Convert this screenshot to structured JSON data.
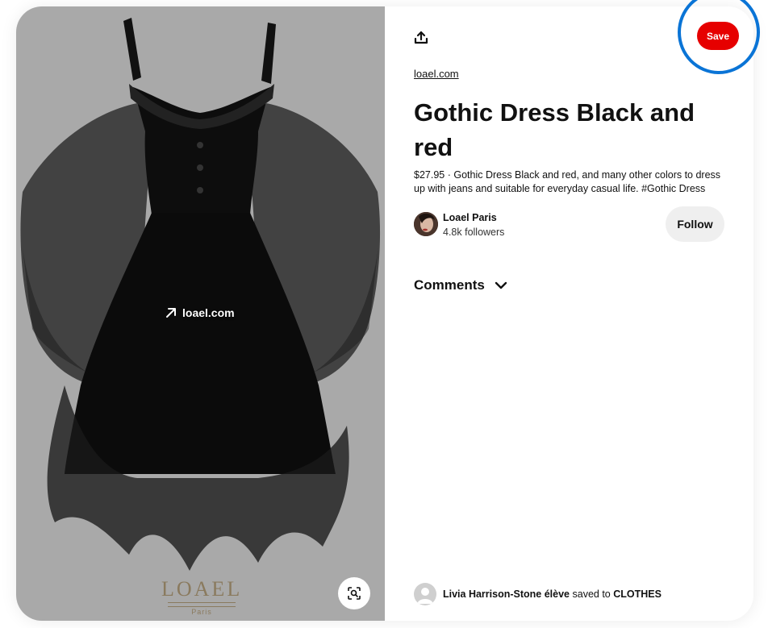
{
  "image": {
    "visit_label": "loael.com",
    "brand_logo_text": "LOAEL",
    "brand_logo_city": "Paris",
    "background_color": "#a9a9a9"
  },
  "toolbar": {
    "share_icon": "share-upload-icon",
    "save_label": "Save",
    "save_color": "#e60000"
  },
  "pin": {
    "source_link": "loael.com",
    "title": "Gothic Dress Black and red",
    "description": "$27.95 · Gothic Dress Black and red, and many other colors to dress up with jeans and suitable for everyday casual life. #Gothic Dress"
  },
  "creator": {
    "name": "Loael Paris",
    "followers": "4.8k followers",
    "follow_label": "Follow"
  },
  "comments": {
    "label": "Comments",
    "icon": "chevron-down-icon"
  },
  "saved_by": {
    "user": "Livia Harrison-Stone élève",
    "connector": "saved to",
    "board": "CLOTHES"
  },
  "accent": {
    "highlight_ring": "#0a74d6"
  }
}
